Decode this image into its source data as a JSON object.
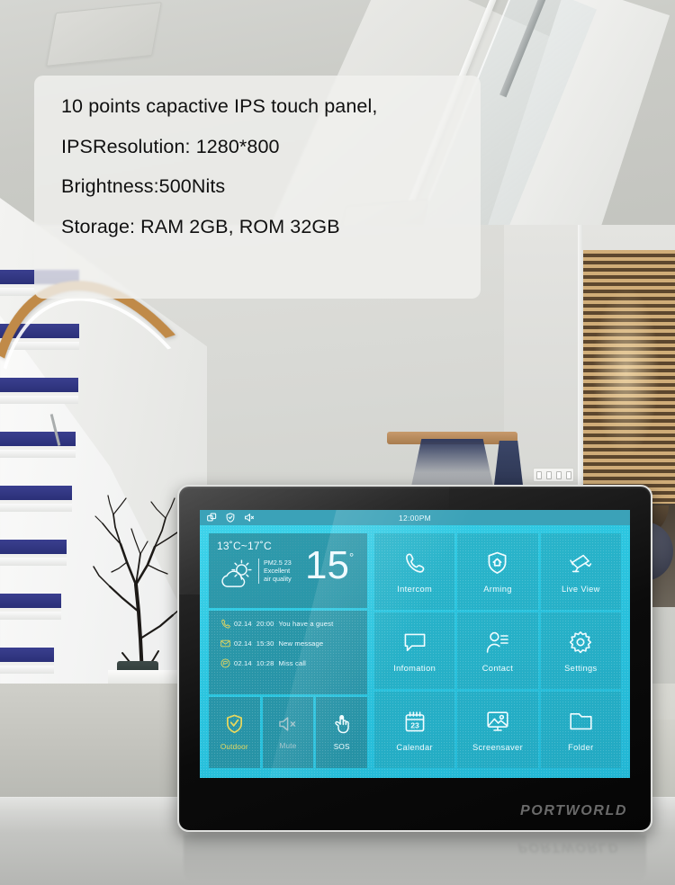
{
  "spec_card": {
    "lines": [
      "10 points capactive IPS touch panel,",
      "IPSResolution: 1280*800",
      "Brightness:500Nits",
      "Storage: RAM 2GB, ROM 32GB"
    ]
  },
  "device": {
    "brand": "PORTWORLD",
    "screen": {
      "statusbar": {
        "icons": [
          "multi-window-icon",
          "shield-icon",
          "mute-icon"
        ],
        "time": "12:00PM"
      },
      "weather": {
        "range": "13˚C~17˚C",
        "pm_label": "PM2.5 23",
        "air_quality_line1": "Excellent",
        "air_quality_line2": "air  quality",
        "temp": "15",
        "degree": "°",
        "icon": "sun-behind-cloud-icon"
      },
      "notifications": [
        {
          "icon": "phone-icon",
          "date": "02.14",
          "time": "20:00",
          "text": "You have a guest"
        },
        {
          "icon": "envelope-icon",
          "date": "02.14",
          "time": "15:30",
          "text": "New message"
        },
        {
          "icon": "chat-icon",
          "date": "02.14",
          "time": "10:28",
          "text": "Miss call"
        }
      ],
      "quick_actions": [
        {
          "label": "Outdoor",
          "icon": "shield-check-icon",
          "state": "active"
        },
        {
          "label": "Mute",
          "icon": "speaker-mute-icon",
          "state": "disabled"
        },
        {
          "label": "SOS",
          "icon": "touch-hand-icon",
          "state": "normal"
        }
      ],
      "apps": [
        {
          "label": "Intercom",
          "icon": "phone-handset-icon"
        },
        {
          "label": "Arming",
          "icon": "shield-home-icon"
        },
        {
          "label": "Live  View",
          "icon": "cctv-camera-icon"
        },
        {
          "label": "Infomation",
          "icon": "speech-bubble-icon"
        },
        {
          "label": "Contact",
          "icon": "person-list-icon"
        },
        {
          "label": "Settings",
          "icon": "gear-icon"
        },
        {
          "label": "Calendar",
          "icon": "calendar-icon",
          "day": "23"
        },
        {
          "label": "Screensaver",
          "icon": "picture-monitor-icon"
        },
        {
          "label": "Folder",
          "icon": "folder-icon"
        }
      ]
    }
  },
  "colors": {
    "screen_cyan": "#2ec9e6",
    "statusbar": "#3ba2b8",
    "tile_left": "rgba(38,110,122,.55)",
    "tile_app": "rgba(34,150,168,.40)",
    "active_yellow": "#e8d75a",
    "notif_yellow": "#e8d75a",
    "bezel_black": "#0b0b0b",
    "logo_gray": "#6a6a6a"
  }
}
